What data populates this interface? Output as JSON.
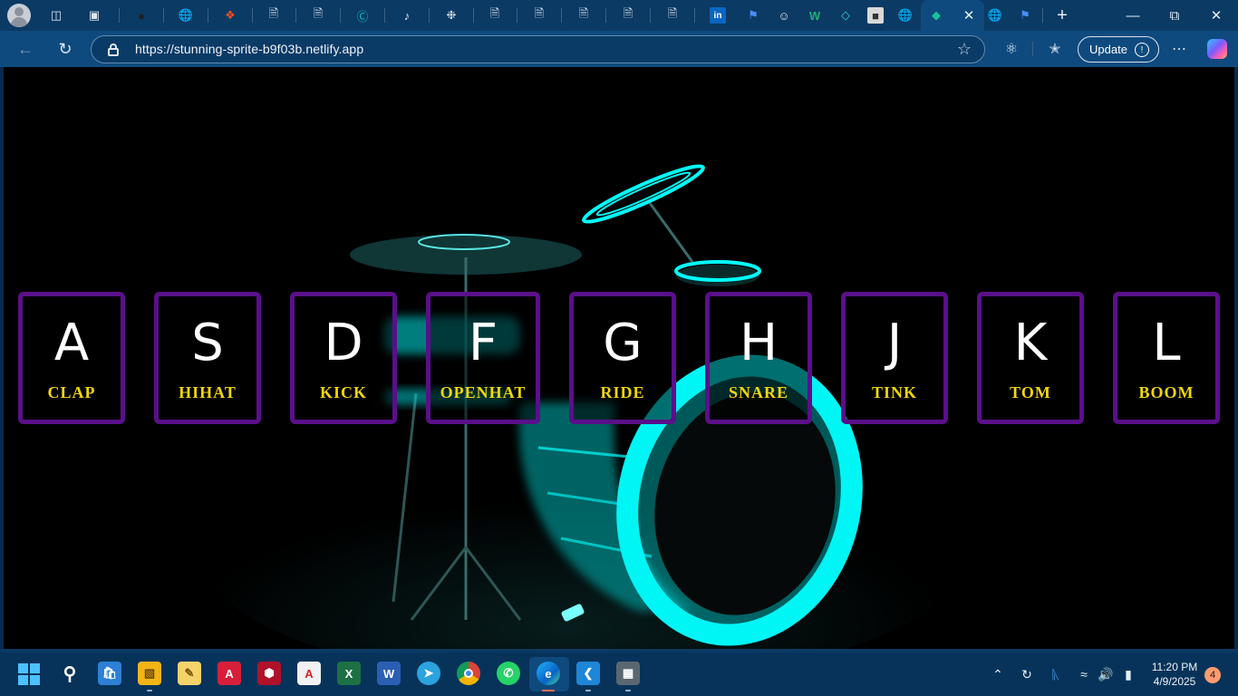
{
  "browser": {
    "url": "https://stunning-sprite-b9f03b.netlify.app",
    "update_label": "Update",
    "update_badge": "!",
    "tab_icons": [
      "workspaces-icon",
      "tab-actions-icon",
      "github-icon",
      "globe-icon",
      "figma-icon",
      "document-icon",
      "document-icon",
      "canva-icon",
      "tiktok-icon",
      "chatgpt-icon",
      "document-icon",
      "document-icon",
      "document-icon",
      "document-icon",
      "document-icon",
      "linkedin-icon",
      "flag-icon",
      "anonymous-icon",
      "webflow-icon",
      "app-icon",
      "profile-photo-icon",
      "globe-icon",
      "active-site-icon",
      "globe-icon",
      "flag-icon"
    ]
  },
  "drum_keys": [
    {
      "key": "A",
      "sound": "CLAP"
    },
    {
      "key": "S",
      "sound": "HIHAT"
    },
    {
      "key": "D",
      "sound": "KICK"
    },
    {
      "key": "F",
      "sound": "OPENHAT"
    },
    {
      "key": "G",
      "sound": "RIDE"
    },
    {
      "key": "H",
      "sound": "SNARE"
    },
    {
      "key": "J",
      "sound": "TINK"
    },
    {
      "key": "K",
      "sound": "TOM"
    },
    {
      "key": "L",
      "sound": "BOOM"
    }
  ],
  "colors": {
    "key_border": "#5a0f8a",
    "key_letter": "#ffffff",
    "key_sound": "#f2d60a",
    "drum_glow": "#00f0f0"
  },
  "taskbar": {
    "apps": [
      "search",
      "microsoft-store",
      "file-explorer",
      "notes",
      "autocad",
      "3d-app",
      "acrobat",
      "excel",
      "word",
      "telegram",
      "chrome",
      "whatsapp",
      "edge",
      "vscode",
      "calculator"
    ],
    "time": "11:20 PM",
    "date": "4/9/2025",
    "notification_count": "4"
  }
}
